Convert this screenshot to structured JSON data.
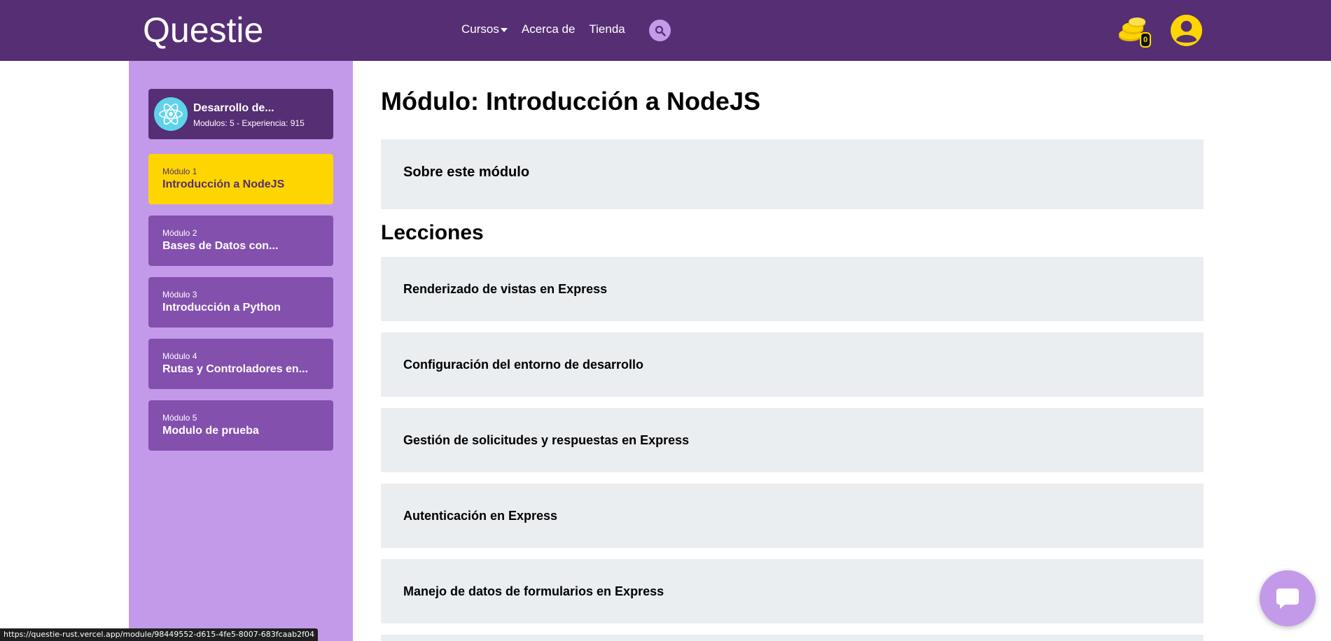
{
  "header": {
    "logo": "Questie",
    "nav": [
      {
        "label": "Cursos",
        "has_dropdown": true
      },
      {
        "label": "Acerca de",
        "has_dropdown": false
      },
      {
        "label": "Tienda",
        "has_dropdown": false
      }
    ],
    "search_icon": "search-icon",
    "coins_count": "0",
    "user_icon": "user-circle-icon",
    "colors": {
      "bar": "#552e74",
      "accent": "#ffd500",
      "search_bg": "#c49be8"
    }
  },
  "sidebar": {
    "course": {
      "title": "Desarrollo de...",
      "meta": "Modulos: 5 - Experiencia: 915",
      "icon": "react-atom-icon"
    },
    "modules": [
      {
        "number": "Módulo 1",
        "title": "Introducción a NodeJS",
        "active": true
      },
      {
        "number": "Módulo 2",
        "title": "Bases de Datos con...",
        "active": false
      },
      {
        "number": "Módulo 3",
        "title": "Introducción a Python",
        "active": false
      },
      {
        "number": "Módulo 4",
        "title": "Rutas y Controladores en...",
        "active": false
      },
      {
        "number": "Módulo 5",
        "title": "Modulo de prueba",
        "active": false
      }
    ],
    "colors": {
      "bg": "#c39ae9",
      "module": "#8350ad",
      "active": "#ffd500"
    }
  },
  "main": {
    "title": "Módulo: Introducción a NodeJS",
    "about_label": "Sobre este módulo",
    "lessons_title": "Lecciones",
    "lessons": [
      "Renderizado de vistas en Express",
      "Configuración del entorno de desarrollo",
      "Gestión de solicitudes y respuestas en Express",
      "Autenticación en Express",
      "Manejo de datos de formularios en Express"
    ]
  },
  "chat": {
    "icon": "chat-bubble-icon"
  },
  "status_bar": {
    "url": "https://questie-rust.vercel.app/module/98449552-d615-4fe5-8007-683fcaab2f04"
  }
}
